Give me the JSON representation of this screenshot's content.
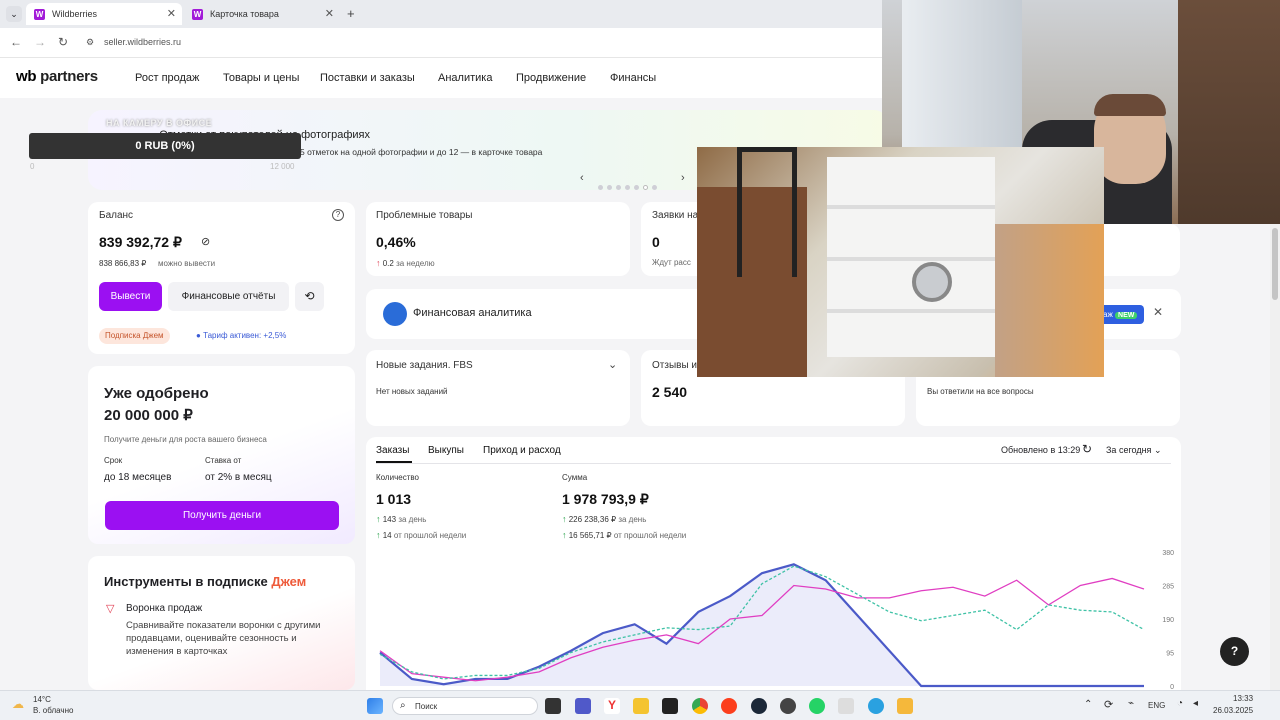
{
  "browser": {
    "tabs": [
      {
        "label": "Wildberries"
      },
      {
        "label": "Карточка товара"
      }
    ],
    "new_tab": "+",
    "url": "seller.wildberries.ru"
  },
  "header": {
    "logo_wb": "wb",
    "logo_partners": "partners",
    "menu": [
      "Рост продаж",
      "Товары и цены",
      "Поставки и заказы",
      "Аналитика",
      "Продвижение",
      "Финансы"
    ]
  },
  "banner": {
    "title": "Отметки от покупателей на фотографиях",
    "subtitle": "5 отметок на одной фотографии и до 12 — в карточке товара"
  },
  "stream_overlay": {
    "label": "НА КАМЕРУ В ОФИСЕ",
    "value": "0 RUB (0%)",
    "min": "0",
    "max": "12 000"
  },
  "balance": {
    "title": "Баланс",
    "amount": "839 392,72 ₽",
    "withdrawable": "838 866,83 ₽",
    "withdrawable_label": "можно вывести",
    "withdraw_btn": "Вывести",
    "reports_btn": "Финансовые отчёты",
    "subscription_pill": "Подписка Джем",
    "tariff": "Тариф активен: +2,5%"
  },
  "problem_goods": {
    "title": "Проблемные товары",
    "value": "0,46%",
    "delta": "0.2",
    "delta_label": "за неделю"
  },
  "requests": {
    "title": "Заявки на",
    "value": "0",
    "sub": "Ждут расс"
  },
  "fin_analytics": {
    "label": "Финансовая аналитика",
    "badge_prefix": "аж",
    "badge": "NEW"
  },
  "fbs": {
    "title": "Новые задания. FBS",
    "sub": "Нет новых заданий"
  },
  "reviews": {
    "title": "Отзывы и",
    "value": "2 540"
  },
  "questions": {
    "sub": "Вы ответили на все вопросы"
  },
  "loan": {
    "title1": "Уже одобрено",
    "title2": "20 000 000 ₽",
    "desc": "Получите деньги для роста вашего бизнеса",
    "term_label": "Срок",
    "term_value": "до 18 месяцев",
    "rate_label": "Ставка от",
    "rate_value": "от 2% в месяц",
    "button": "Получить деньги"
  },
  "tools": {
    "title_main": "Инструменты в подписке ",
    "title_accent": "Джем",
    "item_title": "Воронка продаж",
    "item_desc": "Сравнивайте показатели воронки с другими продавцами, оценивайте сезонность и изменения в карточках"
  },
  "orders": {
    "tabs": [
      "Заказы",
      "Выкупы",
      "Приход и расход"
    ],
    "updated": "Обновлено в 13:29",
    "period": "За сегодня",
    "qty_label": "Количество",
    "qty_value": "1 013",
    "qty_day": "143",
    "qty_day_label": "за день",
    "qty_week": "14",
    "qty_week_label": "от прошлой недели",
    "sum_label": "Сумма",
    "sum_value": "1 978 793,9 ₽",
    "sum_day": "226 238,36 ₽",
    "sum_day_label": "за день",
    "sum_week": "16 565,71 ₽",
    "sum_week_label": "от прошлой недели"
  },
  "chart_data": {
    "type": "line",
    "y_ticks": [
      "380",
      "285",
      "190",
      "95",
      "0"
    ],
    "ylim": [
      0,
      380
    ],
    "series": [
      {
        "values": [
          95,
          20,
          5,
          20,
          20,
          55,
          100,
          150,
          175,
          120,
          210,
          255,
          320,
          345,
          300,
          200,
          100,
          0,
          0,
          0,
          0,
          0,
          0,
          0,
          0
        ]
      },
      {
        "values": [
          100,
          35,
          25,
          15,
          25,
          40,
          80,
          110,
          130,
          145,
          120,
          190,
          200,
          285,
          275,
          250,
          250,
          270,
          280,
          255,
          300,
          230,
          285,
          305,
          275
        ]
      },
      {
        "values": [
          90,
          40,
          20,
          30,
          30,
          50,
          95,
          125,
          145,
          165,
          160,
          170,
          290,
          340,
          310,
          260,
          210,
          185,
          200,
          215,
          160,
          230,
          215,
          210,
          160
        ]
      }
    ],
    "colors": [
      "#4b5ac8",
      "#e03ec2",
      "#3fc2a6"
    ]
  },
  "taskbar": {
    "weather_temp": "14°C",
    "weather_desc": "В. облачно",
    "search": "Поиск",
    "lang": "ENG",
    "time": "13:33",
    "date": "26.03.2025"
  },
  "help": "?"
}
